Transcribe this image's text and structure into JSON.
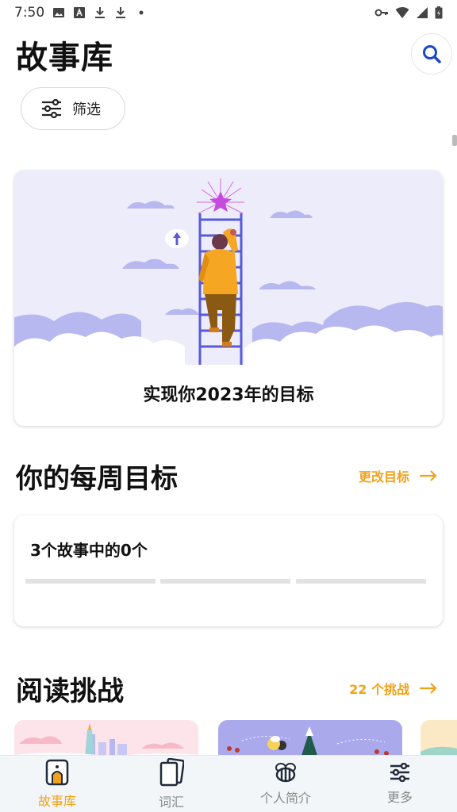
{
  "status_bar": {
    "time": "7:50"
  },
  "header": {
    "title": "故事库",
    "search_icon": "search-icon",
    "filter_label": "筛选"
  },
  "goal_card": {
    "title": "实现你2023年的目标"
  },
  "weekly_goal": {
    "section_title": "你的每周目标",
    "change_link": "更改目标",
    "progress_text": "3个故事中的0个",
    "completed": 0,
    "total": 3
  },
  "reading_challenges": {
    "section_title": "阅读挑战",
    "count_link": "22 个挑战"
  },
  "bottom_nav": {
    "items": [
      {
        "label": "故事库",
        "icon": "library-icon",
        "active": true
      },
      {
        "label": "词汇",
        "icon": "cards-icon",
        "active": false
      },
      {
        "label": "个人简介",
        "icon": "bee-icon",
        "active": false
      },
      {
        "label": "更多",
        "icon": "sliders-icon",
        "active": false
      }
    ]
  },
  "colors": {
    "accent": "#f0a21a",
    "search_icon": "#1a47c8",
    "illustration_bg": "#ececfb",
    "cloud": "#b8b8f0",
    "ladder": "#5a5ad8",
    "star": "#c64ae0"
  }
}
